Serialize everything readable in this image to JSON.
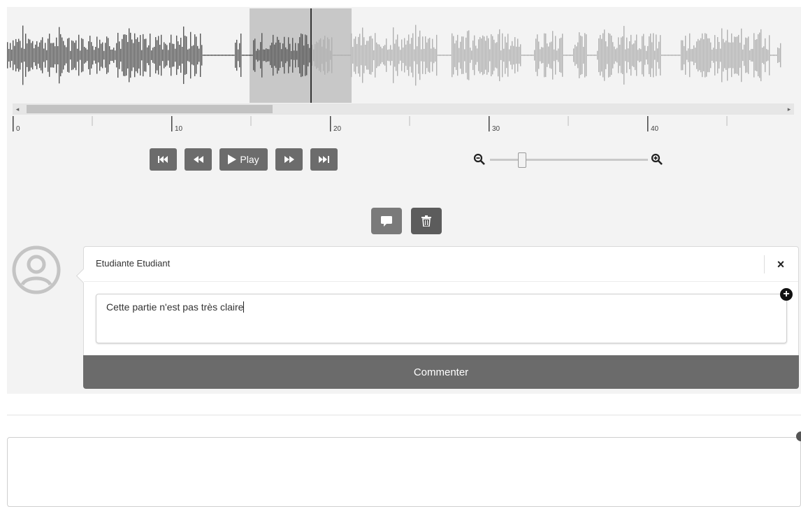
{
  "player": {
    "timeline_ticks": [
      "0",
      "10",
      "20",
      "30",
      "40"
    ],
    "controls": {
      "play_label": "Play"
    },
    "zoom_level": 0.2,
    "colors": {
      "wave_played": "#555555",
      "wave_unplayed": "#b0b0b0",
      "region": "#c8c8c8",
      "button": "#6c6c6c"
    }
  },
  "comment": {
    "author": "Etudiante Etudiant",
    "text": "Cette partie n'est pas très claire",
    "submit_label": "Commenter"
  },
  "icons": {
    "first": "skip-to-start-icon",
    "rewind": "rewind-icon",
    "play": "play-icon",
    "forward": "fast-forward-icon",
    "last": "skip-to-end-icon",
    "zoom_out": "zoom-out-icon",
    "zoom_in": "zoom-in-icon",
    "comment": "comment-icon",
    "delete": "trash-icon",
    "avatar": "user-avatar-icon",
    "close": "close-icon",
    "add": "add-icon"
  }
}
